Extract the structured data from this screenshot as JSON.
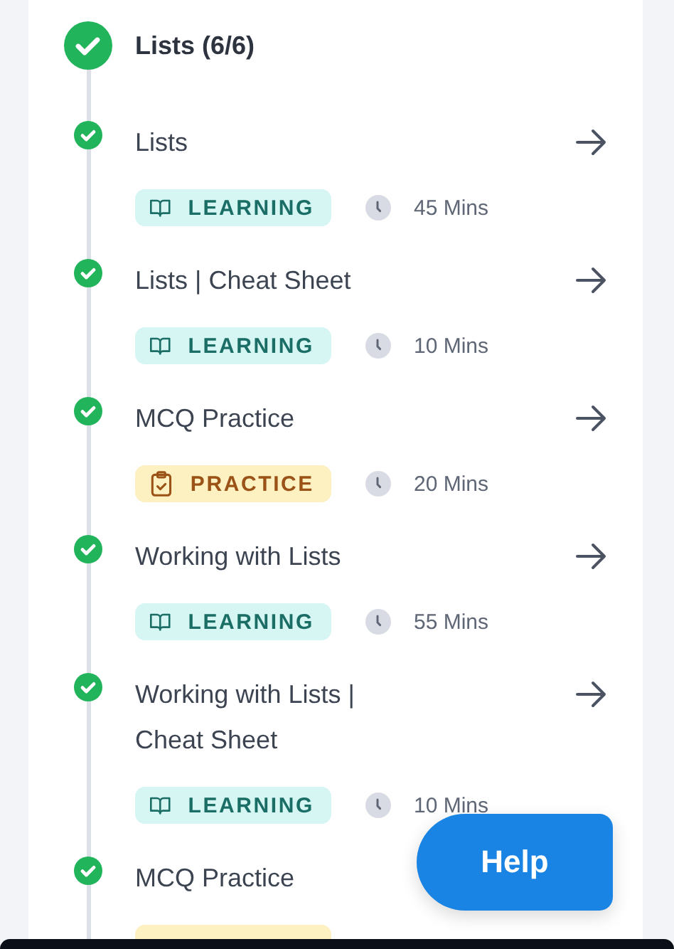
{
  "section": {
    "title": "Lists (6/6)",
    "completed": true
  },
  "items": [
    {
      "title": "Lists",
      "completed": true,
      "kind": "learning",
      "badge": "LEARNING",
      "duration": "45 Mins"
    },
    {
      "title": "Lists | Cheat Sheet",
      "completed": true,
      "kind": "learning",
      "badge": "LEARNING",
      "duration": "10 Mins"
    },
    {
      "title": "MCQ Practice",
      "completed": true,
      "kind": "practice",
      "badge": "PRACTICE",
      "duration": "20 Mins"
    },
    {
      "title": "Working with Lists",
      "completed": true,
      "kind": "learning",
      "badge": "LEARNING",
      "duration": "55 Mins"
    },
    {
      "title": "Working with Lists | Cheat Sheet",
      "completed": true,
      "kind": "learning",
      "badge": "LEARNING",
      "duration": "10 Mins"
    },
    {
      "title": "MCQ Practice",
      "completed": true,
      "kind": "practice"
    }
  ],
  "help_button": "Help"
}
